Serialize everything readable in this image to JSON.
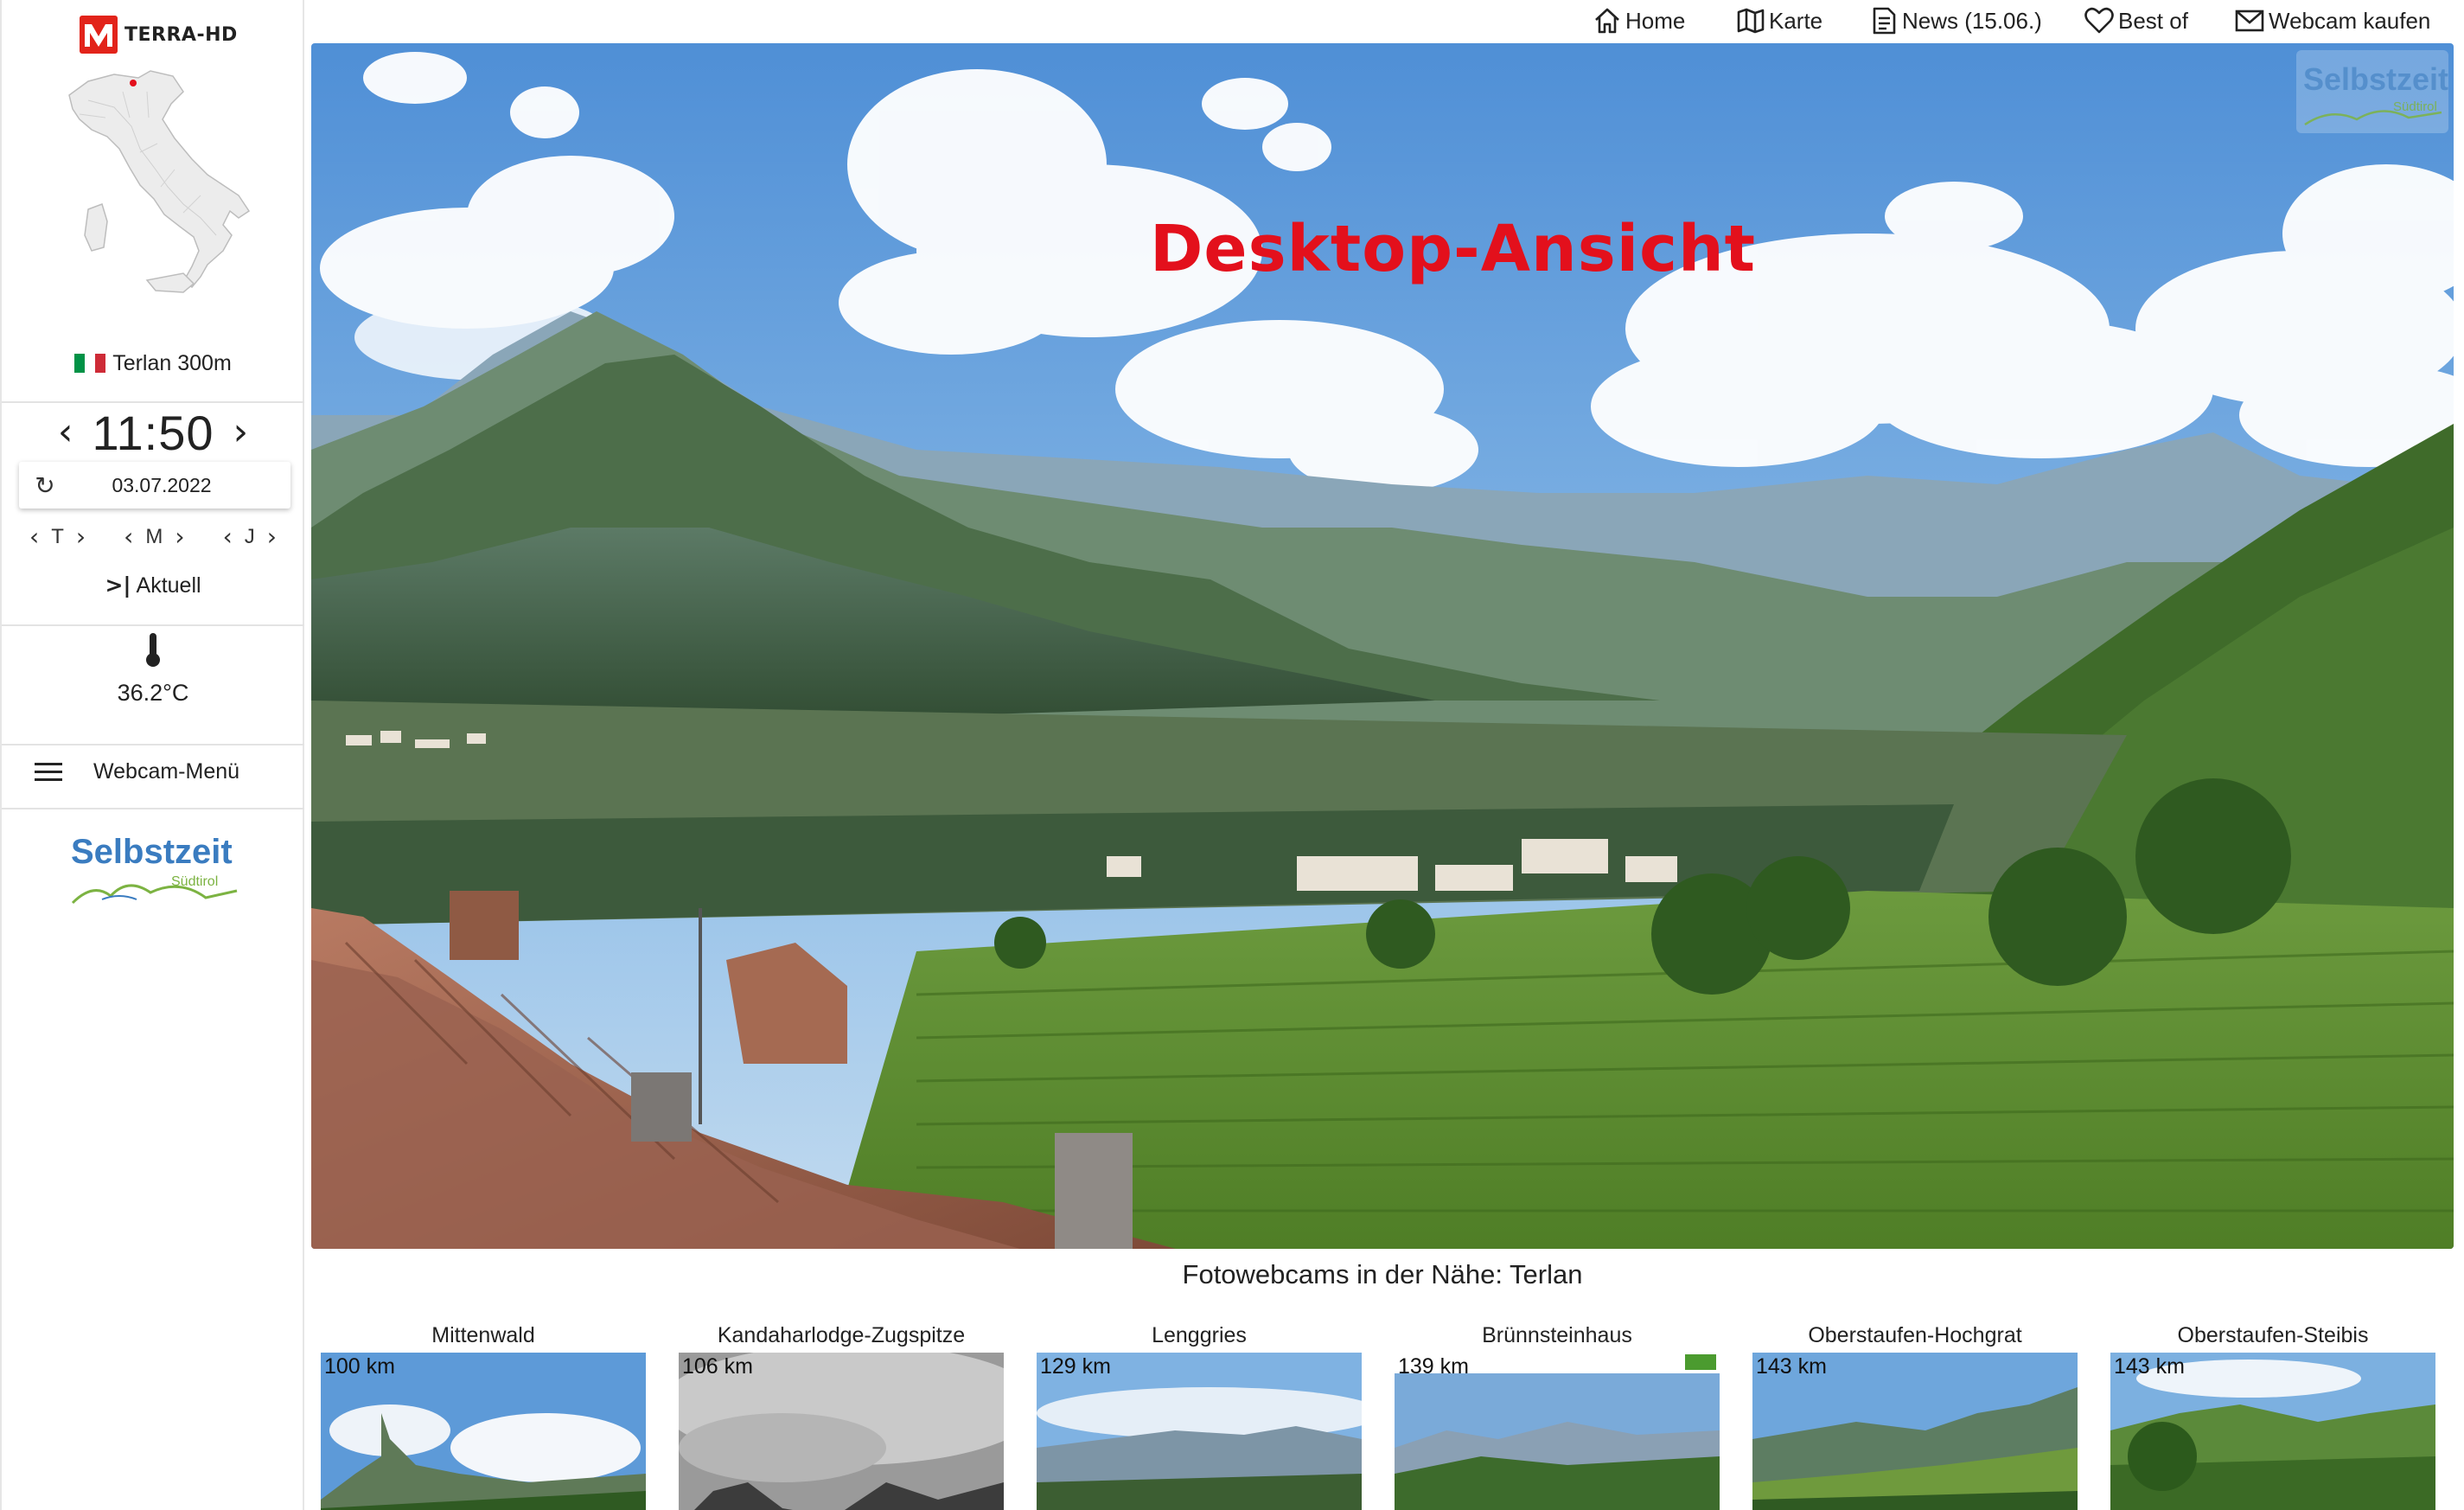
{
  "brand": {
    "name": "TERRA-HD"
  },
  "location": {
    "text": "Terlan 300m",
    "flag_colors": [
      "#009246",
      "#ffffff",
      "#ce2b37"
    ]
  },
  "time_control": {
    "time": "11:50",
    "date": "03.07.2022",
    "prev_glyph": "‹",
    "next_glyph": "›"
  },
  "step_controls": [
    {
      "label": "T"
    },
    {
      "label": "M"
    },
    {
      "label": "J"
    }
  ],
  "aktuell": {
    "icon": ">|",
    "label": "Aktuell"
  },
  "weather": {
    "temperature": "36.2°C"
  },
  "menu": {
    "label": "Webcam-Menü"
  },
  "sponsor_logo": {
    "title": "Selbstzeit",
    "subtitle": "Südtirol",
    "color": "#3a7cc0",
    "accent": "#7cb342"
  },
  "topnav": {
    "items": [
      {
        "label": "Home",
        "icon": "home-icon"
      },
      {
        "label": "Karte",
        "icon": "map-icon"
      },
      {
        "label": "News (15.06.)",
        "icon": "document-icon"
      },
      {
        "label": "Best of",
        "icon": "heart-icon"
      },
      {
        "label": "Webcam kaufen",
        "icon": "mail-icon"
      }
    ]
  },
  "webcam": {
    "overlay_title": "Desktop-Ansicht"
  },
  "nearby": {
    "title": "Fotowebcams in der Nähe: Terlan",
    "items": [
      {
        "name": "Mittenwald",
        "distance": "100 km"
      },
      {
        "name": "Kandaharlodge-Zugspitze",
        "distance": "106 km"
      },
      {
        "name": "Lenggries",
        "distance": "129 km"
      },
      {
        "name": "Brünnsteinhaus",
        "distance": "139 km"
      },
      {
        "name": "Oberstaufen-Hochgrat",
        "distance": "143 km"
      },
      {
        "name": "Oberstaufen-Steibis",
        "distance": "143 km"
      }
    ]
  },
  "colors": {
    "accent_red": "#e3101c",
    "brand_red": "#e2231a",
    "text": "#222222"
  }
}
